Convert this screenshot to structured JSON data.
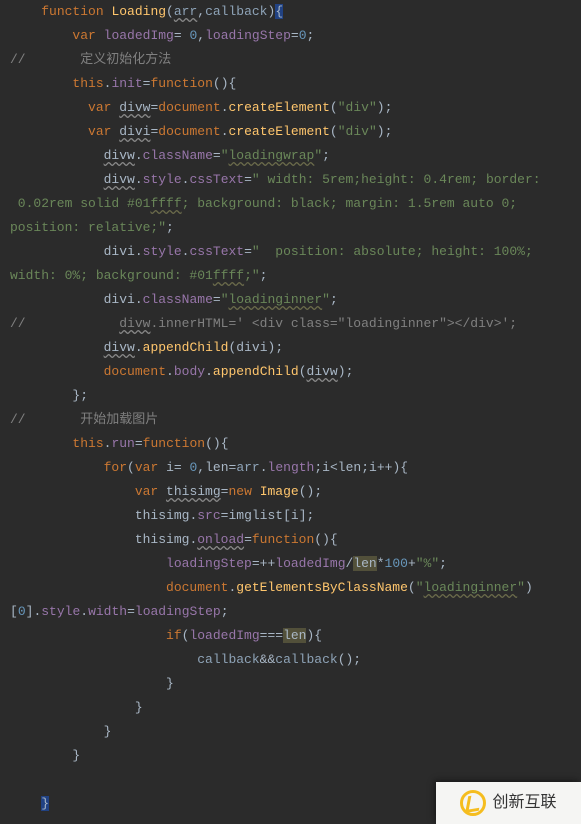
{
  "watermark": {
    "text": "创新互联"
  },
  "lines": [
    {
      "c": "g",
      "segs": [
        {
          "t": "    ",
          "c": "id"
        },
        {
          "t": "function ",
          "c": "kw"
        },
        {
          "t": "Loading",
          "c": "fname"
        },
        {
          "t": "(",
          "c": "par"
        },
        {
          "t": "arr",
          "c": "param wavy"
        },
        {
          "t": ",",
          "c": "op"
        },
        {
          "t": "callback",
          "c": "param"
        },
        {
          "t": ")",
          "c": "par"
        },
        {
          "t": "{",
          "c": "brace sel"
        }
      ]
    },
    {
      "c": "g",
      "segs": [
        {
          "t": "        ",
          "c": "id"
        },
        {
          "t": "var ",
          "c": "kw"
        },
        {
          "t": "loadedImg",
          "c": "prop"
        },
        {
          "t": "= ",
          "c": "op"
        },
        {
          "t": "0",
          "c": "num"
        },
        {
          "t": ",",
          "c": "op"
        },
        {
          "t": "loadingStep",
          "c": "prop"
        },
        {
          "t": "=",
          "c": "op"
        },
        {
          "t": "0",
          "c": "num"
        },
        {
          "t": ";",
          "c": "op"
        }
      ]
    },
    {
      "c": "",
      "segs": [
        {
          "t": "//       定义初始化方法",
          "c": "cmt"
        }
      ]
    },
    {
      "c": "g",
      "segs": [
        {
          "t": "        ",
          "c": "id"
        },
        {
          "t": "this",
          "c": "kwthis"
        },
        {
          "t": ".",
          "c": "op"
        },
        {
          "t": "init",
          "c": "prop"
        },
        {
          "t": "=",
          "c": "op"
        },
        {
          "t": "function",
          "c": "kw"
        },
        {
          "t": "()",
          "c": "par"
        },
        {
          "t": "{",
          "c": "brace"
        }
      ]
    },
    {
      "c": "g",
      "segs": [
        {
          "t": "          ",
          "c": "id"
        },
        {
          "t": "var ",
          "c": "kw"
        },
        {
          "t": "divw",
          "c": "id wavy"
        },
        {
          "t": "=",
          "c": "op"
        },
        {
          "t": "document",
          "c": "doc"
        },
        {
          "t": ".",
          "c": "op"
        },
        {
          "t": "createElement",
          "c": "fname"
        },
        {
          "t": "(",
          "c": "par"
        },
        {
          "t": "\"div\"",
          "c": "str"
        },
        {
          "t": ")",
          "c": "par"
        },
        {
          "t": ";",
          "c": "op"
        }
      ]
    },
    {
      "c": "g",
      "segs": [
        {
          "t": "          ",
          "c": "id"
        },
        {
          "t": "var ",
          "c": "kw"
        },
        {
          "t": "divi",
          "c": "id wavy"
        },
        {
          "t": "=",
          "c": "op"
        },
        {
          "t": "document",
          "c": "doc"
        },
        {
          "t": ".",
          "c": "op"
        },
        {
          "t": "createElement",
          "c": "fname"
        },
        {
          "t": "(",
          "c": "par"
        },
        {
          "t": "\"div\"",
          "c": "str"
        },
        {
          "t": ")",
          "c": "par"
        },
        {
          "t": ";",
          "c": "op"
        }
      ]
    },
    {
      "c": "g",
      "segs": [
        {
          "t": "            ",
          "c": "id"
        },
        {
          "t": "divw",
          "c": "id wavy"
        },
        {
          "t": ".",
          "c": "op"
        },
        {
          "t": "className",
          "c": "prop"
        },
        {
          "t": "=",
          "c": "op"
        },
        {
          "t": "\"",
          "c": "str"
        },
        {
          "t": "loadingwrap",
          "c": "str wavyg"
        },
        {
          "t": "\"",
          "c": "str"
        },
        {
          "t": ";",
          "c": "op"
        }
      ]
    },
    {
      "c": "g",
      "segs": [
        {
          "t": "            ",
          "c": "id"
        },
        {
          "t": "divw",
          "c": "id wavy"
        },
        {
          "t": ".",
          "c": "op"
        },
        {
          "t": "style",
          "c": "prop"
        },
        {
          "t": ".",
          "c": "op"
        },
        {
          "t": "cssText",
          "c": "prop"
        },
        {
          "t": "=",
          "c": "op"
        },
        {
          "t": "\" width: 5rem;height: 0.4rem; border:",
          "c": "str"
        }
      ]
    },
    {
      "c": "",
      "segs": [
        {
          "t": " 0.02rem solid #01",
          "c": "str"
        },
        {
          "t": "ffff",
          "c": "str wavyg"
        },
        {
          "t": "; background: black; margin: 1.5rem auto 0;",
          "c": "str"
        }
      ]
    },
    {
      "c": "",
      "segs": [
        {
          "t": "position: relative;\"",
          "c": "str"
        },
        {
          "t": ";",
          "c": "op"
        }
      ]
    },
    {
      "c": "g",
      "segs": [
        {
          "t": "            ",
          "c": "id"
        },
        {
          "t": "divi",
          "c": "id"
        },
        {
          "t": ".",
          "c": "op"
        },
        {
          "t": "style",
          "c": "prop"
        },
        {
          "t": ".",
          "c": "op"
        },
        {
          "t": "cssText",
          "c": "prop"
        },
        {
          "t": "=",
          "c": "op"
        },
        {
          "t": "\"  position: absolute; height: 100%;",
          "c": "str"
        }
      ]
    },
    {
      "c": "",
      "segs": [
        {
          "t": "width: 0%; background: #01",
          "c": "str"
        },
        {
          "t": "ffff",
          "c": "str wavyg"
        },
        {
          "t": ";\"",
          "c": "str"
        },
        {
          "t": ";",
          "c": "op"
        }
      ]
    },
    {
      "c": "g",
      "segs": [
        {
          "t": "            ",
          "c": "id"
        },
        {
          "t": "divi",
          "c": "id"
        },
        {
          "t": ".",
          "c": "op"
        },
        {
          "t": "className",
          "c": "prop"
        },
        {
          "t": "=",
          "c": "op"
        },
        {
          "t": "\"",
          "c": "str"
        },
        {
          "t": "loadinginner",
          "c": "str wavyg"
        },
        {
          "t": "\"",
          "c": "str"
        },
        {
          "t": ";",
          "c": "op"
        }
      ]
    },
    {
      "c": "",
      "segs": [
        {
          "t": "//            ",
          "c": "cmt"
        },
        {
          "t": "divw",
          "c": "cmt wavy"
        },
        {
          "t": ".innerHTML=' <div class=\"loadinginner\"></div>';",
          "c": "cmt"
        }
      ]
    },
    {
      "c": "g",
      "segs": [
        {
          "t": "            ",
          "c": "id"
        },
        {
          "t": "divw",
          "c": "id wavy"
        },
        {
          "t": ".",
          "c": "op"
        },
        {
          "t": "appendChild",
          "c": "fname"
        },
        {
          "t": "(",
          "c": "par"
        },
        {
          "t": "divi",
          "c": "id"
        },
        {
          "t": ")",
          "c": "par"
        },
        {
          "t": ";",
          "c": "op"
        }
      ]
    },
    {
      "c": "g",
      "segs": [
        {
          "t": "            ",
          "c": "id"
        },
        {
          "t": "document",
          "c": "doc"
        },
        {
          "t": ".",
          "c": "op"
        },
        {
          "t": "body",
          "c": "prop"
        },
        {
          "t": ".",
          "c": "op"
        },
        {
          "t": "appendChild",
          "c": "fname"
        },
        {
          "t": "(",
          "c": "par"
        },
        {
          "t": "divw",
          "c": "id wavy"
        },
        {
          "t": ")",
          "c": "par"
        },
        {
          "t": ";",
          "c": "op"
        }
      ]
    },
    {
      "c": "g",
      "segs": [
        {
          "t": "        ",
          "c": "id"
        },
        {
          "t": "}",
          "c": "brace"
        },
        {
          "t": ";",
          "c": "op"
        }
      ]
    },
    {
      "c": "",
      "segs": [
        {
          "t": "//       开始加载图片",
          "c": "cmt"
        }
      ]
    },
    {
      "c": "g",
      "segs": [
        {
          "t": "        ",
          "c": "id"
        },
        {
          "t": "this",
          "c": "kwthis"
        },
        {
          "t": ".",
          "c": "op"
        },
        {
          "t": "run",
          "c": "prop"
        },
        {
          "t": "=",
          "c": "op"
        },
        {
          "t": "function",
          "c": "kw"
        },
        {
          "t": "()",
          "c": "par"
        },
        {
          "t": "{",
          "c": "brace"
        }
      ]
    },
    {
      "c": "g",
      "segs": [
        {
          "t": "            ",
          "c": "id"
        },
        {
          "t": "for",
          "c": "kw"
        },
        {
          "t": "(",
          "c": "par"
        },
        {
          "t": "var ",
          "c": "kw"
        },
        {
          "t": "i",
          "c": "id"
        },
        {
          "t": "= ",
          "c": "op"
        },
        {
          "t": "0",
          "c": "num"
        },
        {
          "t": ",",
          "c": "op"
        },
        {
          "t": "len",
          "c": "id"
        },
        {
          "t": "=",
          "c": "op"
        },
        {
          "t": "arr",
          "c": "param"
        },
        {
          "t": ".",
          "c": "op"
        },
        {
          "t": "length",
          "c": "prop"
        },
        {
          "t": ";",
          "c": "op"
        },
        {
          "t": "i",
          "c": "id"
        },
        {
          "t": "<",
          "c": "op"
        },
        {
          "t": "len",
          "c": "id"
        },
        {
          "t": ";",
          "c": "op"
        },
        {
          "t": "i",
          "c": "id"
        },
        {
          "t": "++",
          "c": "op"
        },
        {
          "t": ")",
          "c": "par"
        },
        {
          "t": "{",
          "c": "brace"
        }
      ]
    },
    {
      "c": "g",
      "segs": [
        {
          "t": "                ",
          "c": "id"
        },
        {
          "t": "var ",
          "c": "kw"
        },
        {
          "t": "thisimg",
          "c": "id wavy"
        },
        {
          "t": "=",
          "c": "op"
        },
        {
          "t": "new ",
          "c": "kw"
        },
        {
          "t": "Image",
          "c": "fname"
        },
        {
          "t": "()",
          "c": "par"
        },
        {
          "t": ";",
          "c": "op"
        }
      ]
    },
    {
      "c": "g",
      "segs": [
        {
          "t": "                ",
          "c": "id"
        },
        {
          "t": "thisimg",
          "c": "id"
        },
        {
          "t": ".",
          "c": "op"
        },
        {
          "t": "src",
          "c": "prop"
        },
        {
          "t": "=",
          "c": "op"
        },
        {
          "t": "imglist",
          "c": "id"
        },
        {
          "t": "[",
          "c": "par"
        },
        {
          "t": "i",
          "c": "id"
        },
        {
          "t": "]",
          "c": "par"
        },
        {
          "t": ";",
          "c": "op"
        }
      ]
    },
    {
      "c": "g",
      "segs": [
        {
          "t": "                ",
          "c": "id"
        },
        {
          "t": "thisimg",
          "c": "id"
        },
        {
          "t": ".",
          "c": "op"
        },
        {
          "t": "onload",
          "c": "prop wavy"
        },
        {
          "t": "=",
          "c": "op"
        },
        {
          "t": "function",
          "c": "kw"
        },
        {
          "t": "()",
          "c": "par"
        },
        {
          "t": "{",
          "c": "brace"
        }
      ]
    },
    {
      "c": "g",
      "segs": [
        {
          "t": "                    ",
          "c": "id"
        },
        {
          "t": "loadingStep",
          "c": "prop"
        },
        {
          "t": "=",
          "c": "op"
        },
        {
          "t": "++",
          "c": "op"
        },
        {
          "t": "loadedImg",
          "c": "prop"
        },
        {
          "t": "/",
          "c": "op"
        },
        {
          "t": "len",
          "c": "id warnbg"
        },
        {
          "t": "*",
          "c": "op"
        },
        {
          "t": "100",
          "c": "num"
        },
        {
          "t": "+",
          "c": "op"
        },
        {
          "t": "\"%\"",
          "c": "str"
        },
        {
          "t": ";",
          "c": "op"
        }
      ]
    },
    {
      "c": "g",
      "segs": [
        {
          "t": "                    ",
          "c": "id"
        },
        {
          "t": "document",
          "c": "doc"
        },
        {
          "t": ".",
          "c": "op"
        },
        {
          "t": "getElementsByClassName",
          "c": "fname"
        },
        {
          "t": "(",
          "c": "par"
        },
        {
          "t": "\"",
          "c": "str"
        },
        {
          "t": "loadinginner",
          "c": "str wavyg"
        },
        {
          "t": "\"",
          "c": "str"
        },
        {
          "t": ")",
          "c": "par"
        }
      ]
    },
    {
      "c": "",
      "segs": [
        {
          "t": "[",
          "c": "par"
        },
        {
          "t": "0",
          "c": "num"
        },
        {
          "t": "]",
          "c": "par"
        },
        {
          "t": ".",
          "c": "op"
        },
        {
          "t": "style",
          "c": "prop"
        },
        {
          "t": ".",
          "c": "op"
        },
        {
          "t": "width",
          "c": "prop"
        },
        {
          "t": "=",
          "c": "op"
        },
        {
          "t": "loadingStep",
          "c": "prop"
        },
        {
          "t": ";",
          "c": "op"
        }
      ]
    },
    {
      "c": "g",
      "segs": [
        {
          "t": "                    ",
          "c": "id"
        },
        {
          "t": "if",
          "c": "kw"
        },
        {
          "t": "(",
          "c": "par"
        },
        {
          "t": "loadedImg",
          "c": "prop"
        },
        {
          "t": "===",
          "c": "op"
        },
        {
          "t": "len",
          "c": "id warnbg"
        },
        {
          "t": ")",
          "c": "par"
        },
        {
          "t": "{",
          "c": "brace"
        }
      ]
    },
    {
      "c": "g",
      "segs": [
        {
          "t": "                        ",
          "c": "id"
        },
        {
          "t": "callback",
          "c": "param"
        },
        {
          "t": "&&",
          "c": "op"
        },
        {
          "t": "callback",
          "c": "param"
        },
        {
          "t": "()",
          "c": "par"
        },
        {
          "t": ";",
          "c": "op"
        }
      ]
    },
    {
      "c": "g",
      "segs": [
        {
          "t": "                    ",
          "c": "id"
        },
        {
          "t": "}",
          "c": "brace"
        }
      ]
    },
    {
      "c": "g",
      "segs": [
        {
          "t": "                ",
          "c": "id"
        },
        {
          "t": "}",
          "c": "brace"
        }
      ]
    },
    {
      "c": "g",
      "segs": [
        {
          "t": "            ",
          "c": "id"
        },
        {
          "t": "}",
          "c": "brace"
        }
      ]
    },
    {
      "c": "g",
      "segs": [
        {
          "t": "        ",
          "c": "id"
        },
        {
          "t": "}",
          "c": "brace"
        }
      ]
    },
    {
      "c": "",
      "segs": [
        {
          "t": " ",
          "c": "id"
        }
      ]
    },
    {
      "c": "g",
      "segs": [
        {
          "t": "    ",
          "c": "id"
        },
        {
          "t": "}",
          "c": "brace sel"
        }
      ]
    }
  ]
}
